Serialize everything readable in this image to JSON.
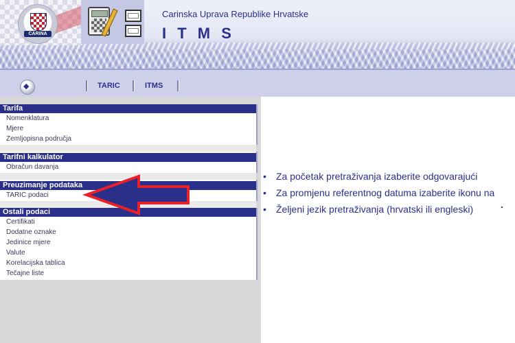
{
  "header": {
    "org_name": "Carinska Uprava Republike Hrvatske",
    "app_name": "I T M S",
    "crest_text": "CARINA"
  },
  "nav": {
    "home_symbol": "◆",
    "links": [
      "TARIC",
      "ITMS"
    ]
  },
  "menu": {
    "sections": [
      {
        "title": "Tarifa",
        "items": [
          "Nomenklatura",
          "Mjere",
          "Zemljopisna područja"
        ]
      },
      {
        "title": "Tarifni kalkulator",
        "items": [
          "Obračun davanja"
        ]
      },
      {
        "title": "Preuzimanje podataka",
        "items": [
          "TARIC podaci"
        ]
      },
      {
        "title": "Ostali podaci",
        "items": [
          "Certifikati",
          "Dodatne oznake",
          "Jedinice mjere",
          "Valute",
          "Korelacijska tablica",
          "Tečajne liste"
        ]
      }
    ]
  },
  "content": {
    "bullets": [
      "Za početak pretraživanja izaberite odgovarajući",
      "Za promjenu referentnog datuma izaberite ikonu na",
      "Željeni jezik pretraživanja (hrvatski ili engleski)"
    ]
  },
  "colors": {
    "brand": "#2a2f8a",
    "annotation_arrow": "#e8202a"
  }
}
